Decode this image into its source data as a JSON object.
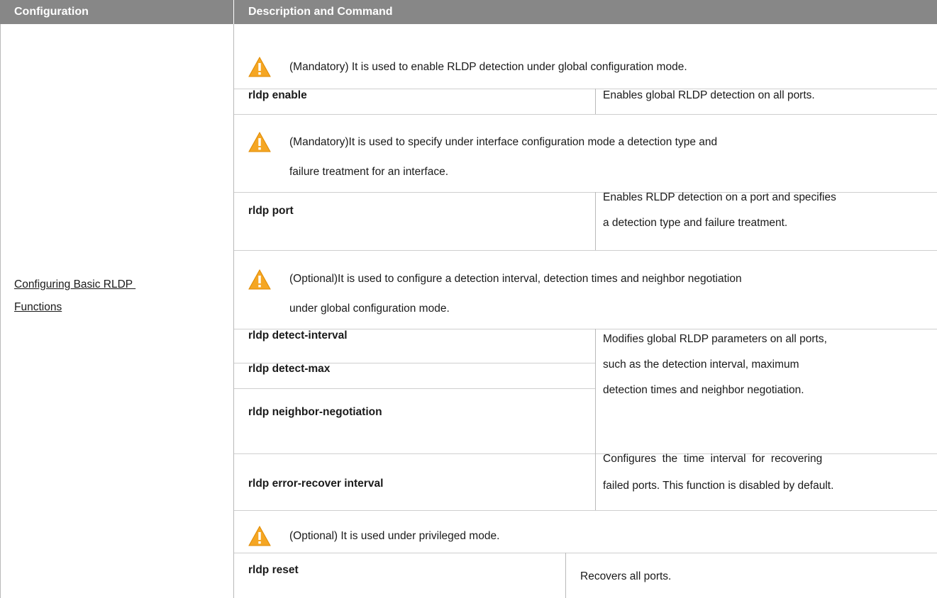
{
  "table": {
    "header": {
      "col1": "Configuration",
      "col2": "Description and Command"
    },
    "configuration": {
      "line1": "Configuring Basic RLDP ",
      "line2": "Functions"
    },
    "notes": {
      "n1": "(Mandatory) It is used to enable RLDP detection under global configuration mode.",
      "n2a": "(Mandatory)It is used to specify under interface configuration mode a detection type and",
      "n2b": "failure treatment for an interface.",
      "n3a": "(Optional)It is used to configure a detection interval, detection times and neighbor negotiation",
      "n3b": "under global configuration mode.",
      "n4": "(Optional) It is used under privileged mode."
    },
    "commands": {
      "rldp_enable": "rldp enable",
      "rldp_port": "rldp port",
      "rldp_detect_interval": "rldp detect-interval",
      "rldp_detect_max": "rldp detect-max",
      "rldp_neighbor_negotiation": "rldp neighbor-negotiation",
      "rldp_error_recover": "rldp error-recover interval",
      "rldp_reset": "rldp reset"
    },
    "descriptions": {
      "enable": "Enables global RLDP detection on all ports.",
      "port_a": "Enables RLDP detection on a port and specifies",
      "port_b": "a detection type and failure treatment.",
      "params_a": "Modifies global RLDP parameters on all ports,",
      "params_b": "such as the detection interval, maximum",
      "params_c": "detection times and neighbor negotiation.",
      "recover_a": "Configures  the  time  interval  for  recovering",
      "recover_b": "failed ports. This function is disabled by default.",
      "reset": "Recovers all ports."
    },
    "icon": "warning-triangle-icon",
    "colors": {
      "header_bg": "#878787",
      "warning": "#f5a623"
    }
  }
}
